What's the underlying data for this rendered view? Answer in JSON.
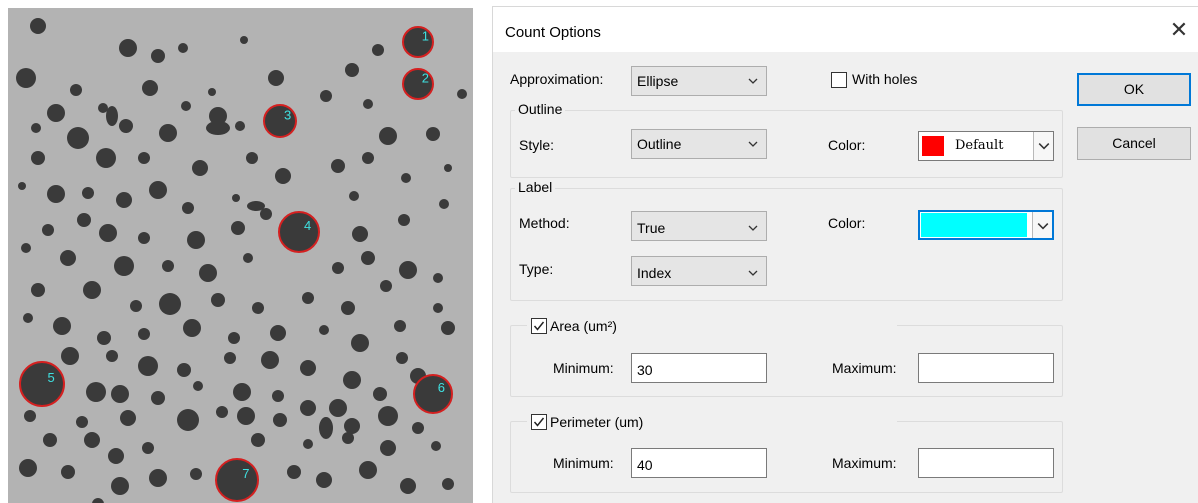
{
  "micrograph": {
    "labels": [
      "1",
      "2",
      "3",
      "4",
      "5",
      "6",
      "7"
    ],
    "colors": {
      "background": "#b3b3b3",
      "particle": "#3a3a3a",
      "outline": "#d42020",
      "label": "#3fe0e0"
    }
  },
  "dialog": {
    "title": "Count Options",
    "close_icon": "close-icon",
    "approximation": {
      "label": "Approximation:",
      "value": "Ellipse"
    },
    "with_holes": {
      "label": "With holes",
      "checked": false
    },
    "ok_label": "OK",
    "cancel_label": "Cancel",
    "outline": {
      "group_title": "Outline",
      "style_label": "Style:",
      "style_value": "Outline",
      "color_label": "Color:",
      "color_value": "Default",
      "color_swatch": "#ff0000"
    },
    "label": {
      "group_title": "Label",
      "method_label": "Method:",
      "method_value": "True",
      "color_label": "Color:",
      "color_swatch": "#00ffff",
      "type_label": "Type:",
      "type_value": "Index"
    },
    "area": {
      "title": "Area (um²)",
      "checked": true,
      "min_label": "Minimum:",
      "min_value": "30",
      "max_label": "Maximum:",
      "max_value": ""
    },
    "perimeter": {
      "title": "Perimeter (um)",
      "checked": true,
      "min_label": "Minimum:",
      "min_value": "40",
      "max_label": "Maximum:",
      "max_value": ""
    }
  }
}
